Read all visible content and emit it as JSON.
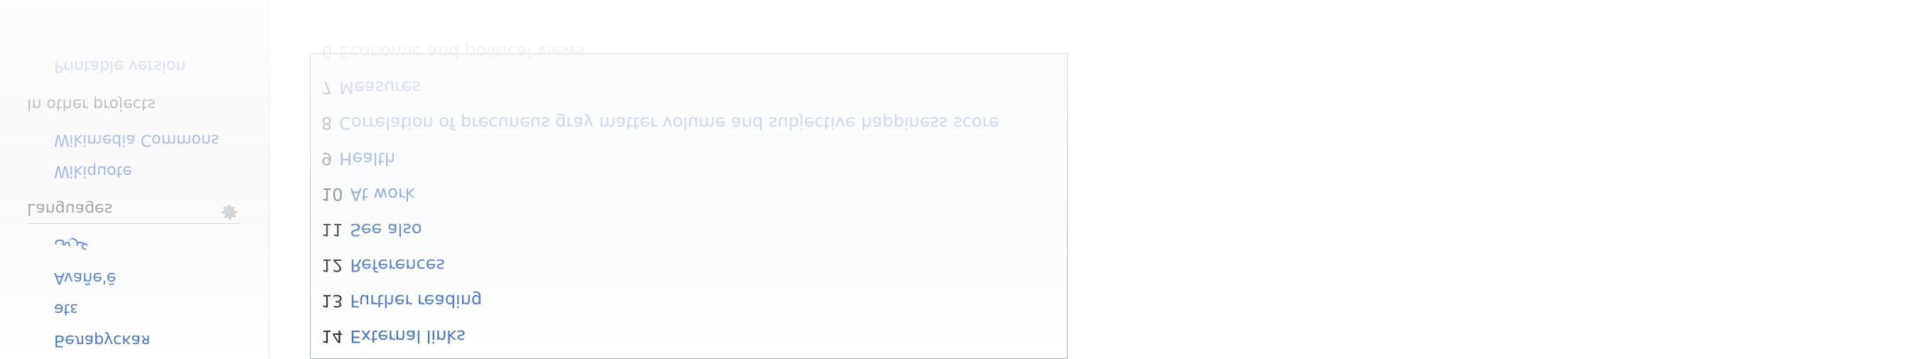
{
  "sidebar": {
    "other_projects": {
      "heading": "In other projects",
      "items": [
        "Wikimedia Commons",
        "Wikiquote"
      ],
      "extra_item": "Printable version"
    },
    "languages": {
      "heading": "Languages",
      "items": [
        "عربی",
        "Avañe'ẽ",
        "ətɛ",
        "Беларуская"
      ]
    }
  },
  "toc": {
    "items": [
      {
        "num": "6",
        "label": "Economic and political views"
      },
      {
        "num": "7",
        "label": "Measures"
      },
      {
        "num": "8",
        "label": "Correlation of precuneus gray matter volume and subjective happiness score"
      },
      {
        "num": "9",
        "label": "Health"
      },
      {
        "num": "10",
        "label": "At work"
      },
      {
        "num": "11",
        "label": "See also"
      },
      {
        "num": "12",
        "label": "References"
      },
      {
        "num": "13",
        "label": "Further reading"
      },
      {
        "num": "14",
        "label": "External links"
      }
    ]
  },
  "colors": {
    "link": "#3366cc",
    "text": "#202122",
    "muted": "#72777d",
    "border": "#a2a9b1"
  }
}
